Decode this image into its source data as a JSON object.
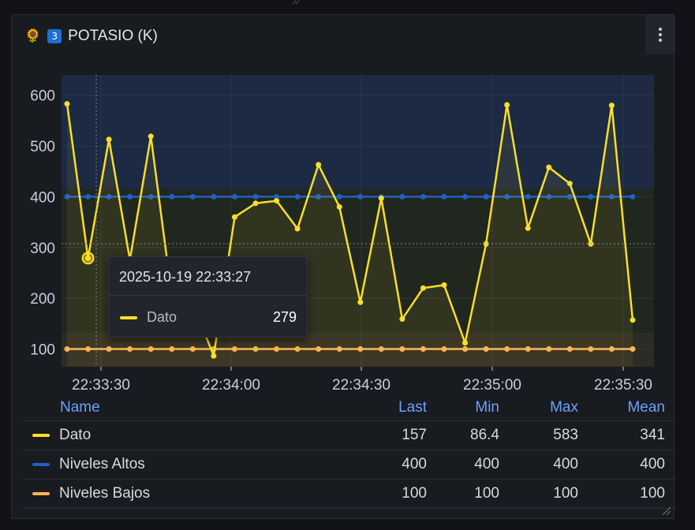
{
  "panel": {
    "emoji": "🌻",
    "keycap": "3",
    "title": "POTASIO (K)",
    "menu_icon": "kebab-vertical-icon"
  },
  "colors": {
    "dato": "#fade2a",
    "altos": "#1f60c4",
    "bajos": "#ffb357",
    "band_high": "#1c2a43",
    "band_mid": "#20271f",
    "band_low": "#2d2b25"
  },
  "chart_data": {
    "type": "line",
    "ylim": [
      65,
      640
    ],
    "yticks": [
      100,
      200,
      300,
      400,
      500,
      600
    ],
    "xticks": [
      "22:33:30",
      "22:34:00",
      "22:34:30",
      "22:35:00",
      "22:35:30"
    ],
    "grid": true,
    "thresholds": {
      "low": 100,
      "high": 400
    },
    "series": [
      {
        "name": "Dato",
        "color": "#fade2a",
        "values": [
          583,
          279,
          513,
          276,
          519,
          205,
          190,
          86.4,
          360,
          387,
          392,
          337,
          463,
          380,
          192,
          397,
          159,
          220,
          226,
          112,
          307,
          581,
          338,
          458,
          426,
          307,
          580,
          157
        ]
      },
      {
        "name": "Niveles Altos",
        "color": "#1f60c4",
        "values": [
          400,
          400,
          400,
          400,
          400,
          400,
          400,
          400,
          400,
          400,
          400,
          400,
          400,
          400,
          400,
          400,
          400,
          400,
          400,
          400,
          400,
          400,
          400,
          400,
          400,
          400,
          400,
          400
        ]
      },
      {
        "name": "Niveles Bajos",
        "color": "#ffb357",
        "values": [
          100,
          100,
          100,
          100,
          100,
          100,
          100,
          100,
          100,
          100,
          100,
          100,
          100,
          100,
          100,
          100,
          100,
          100,
          100,
          100,
          100,
          100,
          100,
          100,
          100,
          100,
          100,
          100
        ]
      }
    ]
  },
  "tooltip": {
    "time": "2025-10-19 22:33:27",
    "label": "Dato",
    "value": "279"
  },
  "legend": {
    "headers": {
      "name": "Name",
      "last": "Last",
      "min": "Min",
      "max": "Max",
      "mean": "Mean"
    },
    "rows": [
      {
        "name": "Dato",
        "color": "#fade2a",
        "last": "157",
        "min": "86.4",
        "max": "583",
        "mean": "341"
      },
      {
        "name": "Niveles Altos",
        "color": "#1f60c4",
        "last": "400",
        "min": "400",
        "max": "400",
        "mean": "400"
      },
      {
        "name": "Niveles Bajos",
        "color": "#ffb357",
        "last": "100",
        "min": "100",
        "max": "100",
        "mean": "100"
      }
    ]
  }
}
